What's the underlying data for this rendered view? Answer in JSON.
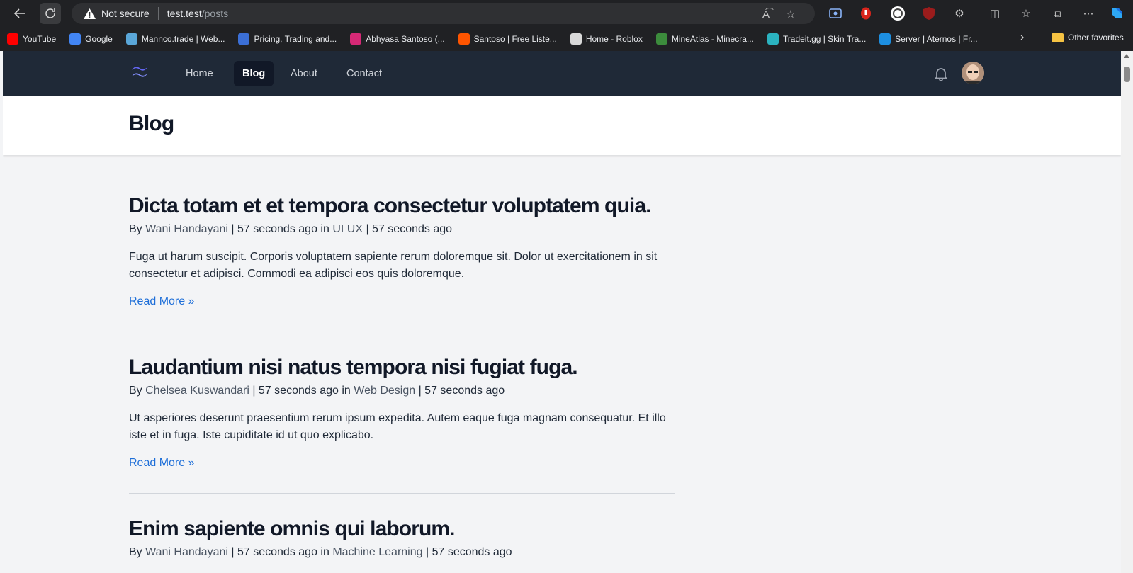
{
  "browser": {
    "security_label": "Not secure",
    "url_host": "test.test",
    "url_path": "/posts",
    "bookmarks": [
      {
        "label": "YouTube",
        "color": "#ff0000"
      },
      {
        "label": "Google",
        "color": "#4285f4"
      },
      {
        "label": "Mannco.trade | Web...",
        "color": "#5aa7d8"
      },
      {
        "label": "Pricing, Trading and...",
        "color": "#3b6fd6"
      },
      {
        "label": "Abhyasa Santoso (...",
        "color": "#d62976"
      },
      {
        "label": "Santoso | Free Liste...",
        "color": "#ff5500"
      },
      {
        "label": "Home - Roblox",
        "color": "#d9d9d9"
      },
      {
        "label": "MineAtlas - Minecra...",
        "color": "#3c8c3c"
      },
      {
        "label": "Tradeit.gg | Skin Tra...",
        "color": "#2bb3c0"
      },
      {
        "label": "Server | Aternos | Fr...",
        "color": "#1d8fe1"
      }
    ],
    "other_favorites": "Other favorites"
  },
  "nav": {
    "items": [
      "Home",
      "Blog",
      "About",
      "Contact"
    ],
    "active": "Blog"
  },
  "header": {
    "title": "Blog"
  },
  "posts": [
    {
      "title": "Dicta totam et et tempora consectetur voluptatem quia.",
      "by": "By",
      "author": "Wani Handayani",
      "time": "57 seconds ago",
      "in": "in",
      "category": "UI UX",
      "time2": "57 seconds ago",
      "excerpt": "Fuga ut harum suscipit. Corporis voluptatem sapiente rerum doloremque sit. Dolor ut exercitationem in sit consectetur et adipisci. Commodi ea adipisci eos quis doloremque.",
      "read_more": "Read More »"
    },
    {
      "title": "Laudantium nisi natus tempora nisi fugiat fuga.",
      "by": "By",
      "author": "Chelsea Kuswandari",
      "time": "57 seconds ago",
      "in": "in",
      "category": "Web Design",
      "time2": "57 seconds ago",
      "excerpt": "Ut asperiores deserunt praesentium rerum ipsum expedita. Autem eaque fuga magnam consequatur. Et illo iste et in fuga. Iste cupiditate id ut quo explicabo.",
      "read_more": "Read More »"
    },
    {
      "title": "Enim sapiente omnis qui laborum.",
      "by": "By",
      "author": "Wani Handayani",
      "time": "57 seconds ago",
      "in": "in",
      "category": "Machine Learning",
      "time2": "57 seconds ago"
    }
  ]
}
